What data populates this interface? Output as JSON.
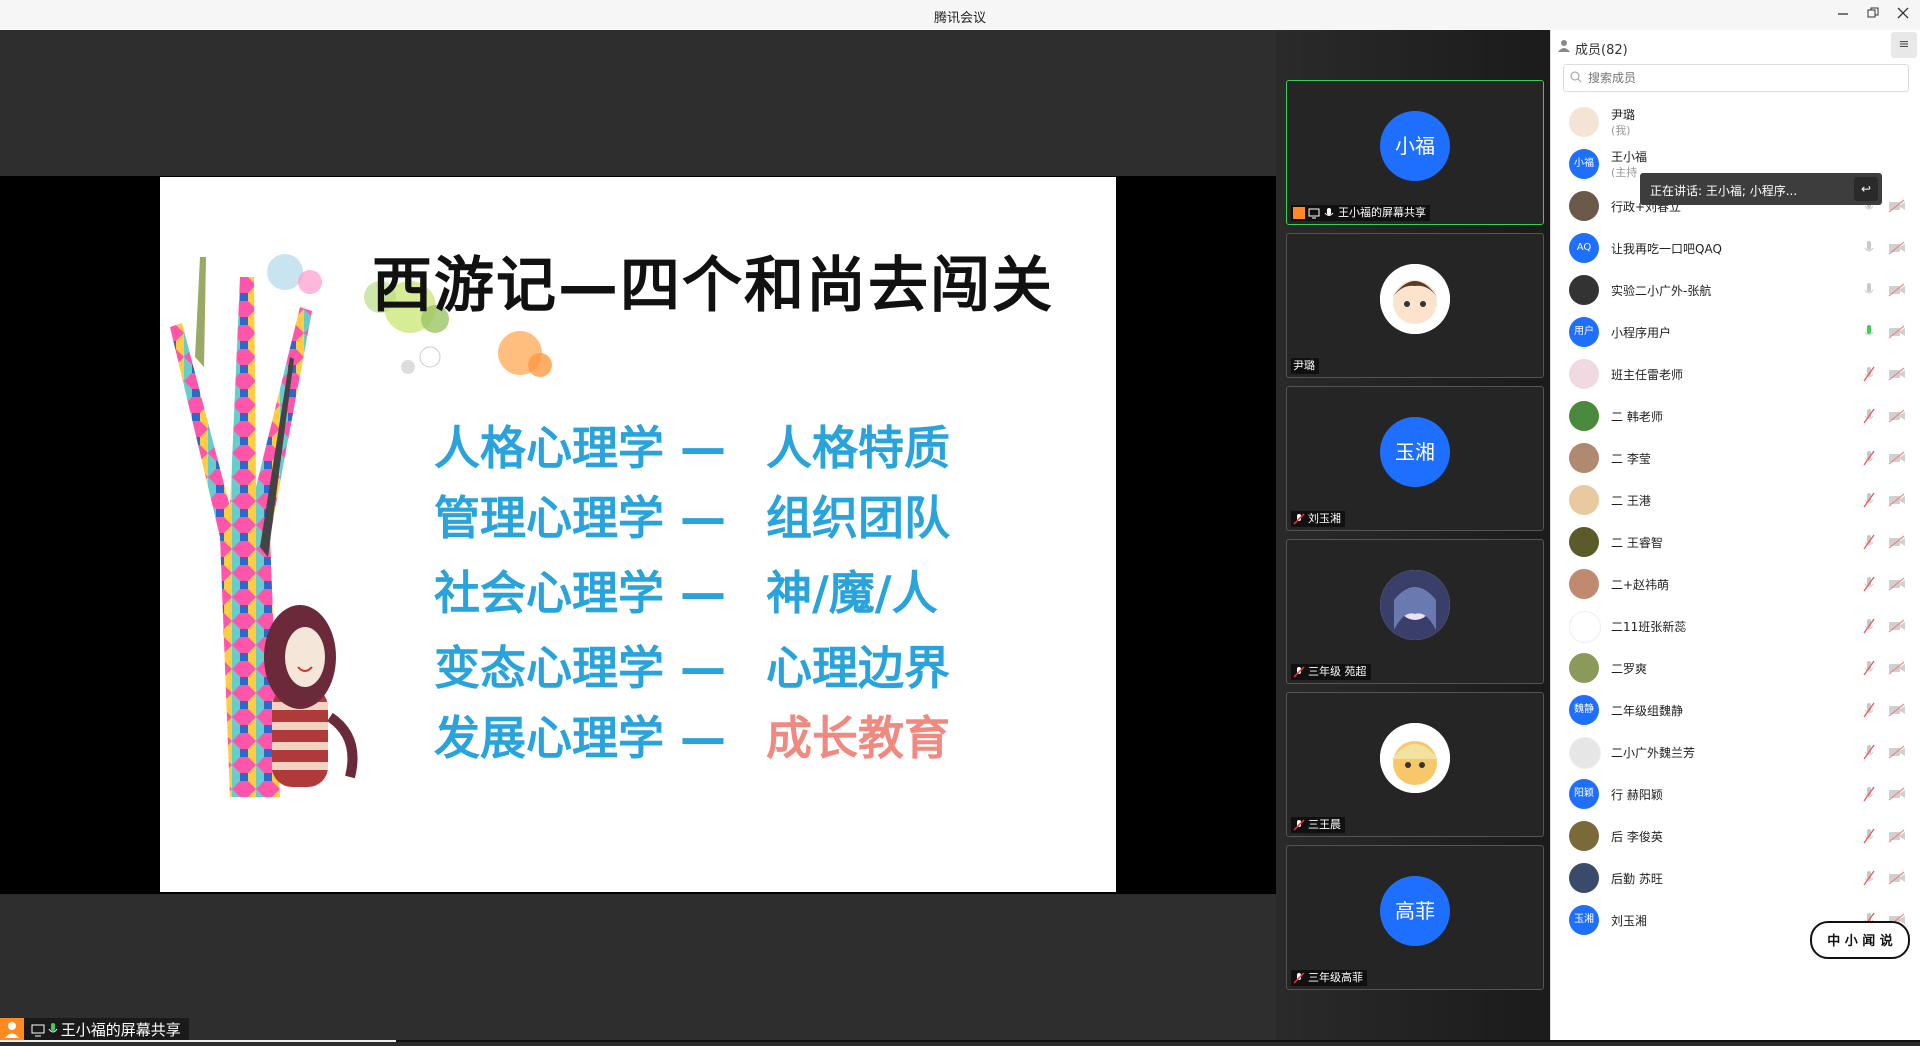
{
  "window": {
    "title": "腾讯会议",
    "minimize_icon": "minimize-icon",
    "restore_icon": "restore-icon",
    "close_icon": "close-icon"
  },
  "slide": {
    "title": "西游记—四个和尚去闯关",
    "pairs": [
      {
        "left": "人格心理学 —",
        "right": "人格特质",
        "right_color": "#29a3dc"
      },
      {
        "left": "管理心理学 —",
        "right": "组织团队",
        "right_color": "#29a3dc"
      },
      {
        "left": "社会心理学 —",
        "right": "神/魔/人",
        "right_color": "#29a3dc"
      },
      {
        "left": "变态心理学 —",
        "right": "心理边界",
        "right_color": "#29a3dc"
      },
      {
        "left": "发展心理学 —",
        "right": "成长教育",
        "right_color": "#f08a80"
      }
    ]
  },
  "video_tiles": [
    {
      "avatar_text": "小福",
      "label": "王小福的屏幕共享",
      "active": true
    },
    {
      "avatar_text": "",
      "label": "尹璐",
      "active": false
    },
    {
      "avatar_text": "玉湘",
      "label": "刘玉湘",
      "active": false
    },
    {
      "avatar_text": "",
      "label": "三年级 苑超",
      "active": false
    },
    {
      "avatar_text": "",
      "label": "三王晨",
      "active": false
    },
    {
      "avatar_text": "高菲",
      "label": "三年级高菲",
      "active": false
    }
  ],
  "members": {
    "header": "成员(82)",
    "menu_icon": "hamburger-menu-icon",
    "search_placeholder": "搜索成员",
    "list": [
      {
        "name": "尹璐",
        "sub": "(我)",
        "avatar": "",
        "avatar_color": "#f3e4d6",
        "mic": "none"
      },
      {
        "name": "王小福",
        "sub": "(主持",
        "avatar": "小福",
        "avatar_color": "#1f6fff",
        "mic": "none"
      },
      {
        "name": "行政+刘春立",
        "sub": "",
        "avatar": "",
        "avatar_color": "#6b5a4a",
        "mic": "off-gray"
      },
      {
        "name": "让我再吃一口吧QAQ",
        "sub": "",
        "avatar": "AQ",
        "avatar_color": "#1f6fff",
        "mic": "off-gray"
      },
      {
        "name": "实验二小广外-张航",
        "sub": "",
        "avatar": "",
        "avatar_color": "#333333",
        "mic": "off-gray"
      },
      {
        "name": "小程序用户",
        "sub": "",
        "avatar": "用户",
        "avatar_color": "#1f6fff",
        "mic": "on-green"
      },
      {
        "name": "班主任雷老师",
        "sub": "",
        "avatar": "",
        "avatar_color": "#f0d9e0",
        "mic": "muted-red"
      },
      {
        "name": "二 韩老师",
        "sub": "",
        "avatar": "",
        "avatar_color": "#4a8a3c",
        "mic": "muted-red"
      },
      {
        "name": "二 李莹",
        "sub": "",
        "avatar": "",
        "avatar_color": "#b08a70",
        "mic": "muted-red"
      },
      {
        "name": "二 王港",
        "sub": "",
        "avatar": "",
        "avatar_color": "#e8c9a0",
        "mic": "muted-red"
      },
      {
        "name": "二 王睿智",
        "sub": "",
        "avatar": "",
        "avatar_color": "#5a5a2a",
        "mic": "muted-red"
      },
      {
        "name": "二+赵祎萌",
        "sub": "",
        "avatar": "",
        "avatar_color": "#c08a70",
        "mic": "muted-red"
      },
      {
        "name": "二11班张新蕊",
        "sub": "",
        "avatar": "",
        "avatar_color": "#ffffff",
        "mic": "muted-red"
      },
      {
        "name": "二罗爽",
        "sub": "",
        "avatar": "",
        "avatar_color": "#8a9a5a",
        "mic": "muted-red"
      },
      {
        "name": "二年级组魏静",
        "sub": "",
        "avatar": "魏静",
        "avatar_color": "#1f6fff",
        "mic": "muted-red"
      },
      {
        "name": "二小广外魏兰芳",
        "sub": "",
        "avatar": "",
        "avatar_color": "#e6e6e6",
        "mic": "muted-red"
      },
      {
        "name": "行 赫阳颖",
        "sub": "",
        "avatar": "阳颖",
        "avatar_color": "#1f6fff",
        "mic": "muted-red"
      },
      {
        "name": "后 李俊英",
        "sub": "",
        "avatar": "",
        "avatar_color": "#7a6a3a",
        "mic": "muted-red"
      },
      {
        "name": "后勤 苏旺",
        "sub": "",
        "avatar": "",
        "avatar_color": "#3a4a6a",
        "mic": "muted-red"
      },
      {
        "name": "刘玉湘",
        "sub": "",
        "avatar": "玉湘",
        "avatar_color": "#1f6fff",
        "mic": "muted-red"
      }
    ]
  },
  "speaking_tooltip": {
    "text": "正在讲话: 王小福; 小程序...",
    "back_icon": "reply-arrow-icon"
  },
  "bottom_label": "王小福的屏幕共享",
  "watermark": "中 小 闻 说",
  "playback_progress": 0.206
}
